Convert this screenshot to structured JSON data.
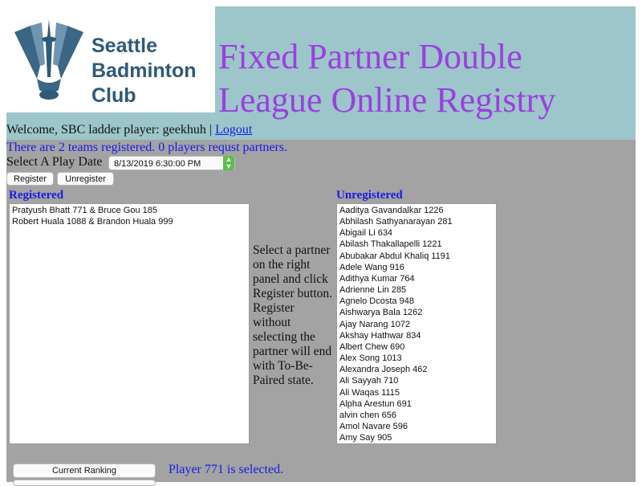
{
  "header": {
    "title": "Fixed Partner Double League Online Registry",
    "logo_line1": "Seattle",
    "logo_line2": "Badminton",
    "logo_line3": "Club"
  },
  "welcome": {
    "text": "Welcome, SBC ladder player: geekhuh |",
    "logout_label": "Logout"
  },
  "status_text": "There are 2 teams registered. 0 players requst partners.",
  "play_date": {
    "label": "Select A Play Date",
    "selected": "8/13/2019 6:30:00 PM"
  },
  "buttons": {
    "register": "Register",
    "unregister": "Unregister",
    "current_ranking": "Current Ranking"
  },
  "registered": {
    "heading": "Registered",
    "items": [
      "Pratyush Bhatt 771 & Bruce Gou 185",
      "Robert Huala 1088 & Brandon Huala 999"
    ]
  },
  "instructions": "Select a partner on the right panel and click Register button. Register without selecting the partner will end with To-Be-Paired state.",
  "unregistered": {
    "heading": "Unregistered",
    "items": [
      "Aaditya Gavandalkar 1226",
      "Abhilash Sathyanarayan 281",
      "Abigail Li 634",
      "Abilash Thakallapelli 1221",
      "Abubakar Abdul Khaliq 1191",
      "Adele Wang 916",
      "Adithya Kumar 764",
      "Adrienne Lin 285",
      "Agnelo Dcosta 948",
      "Aishwarya Bala 1262",
      "Ajay Narang 1072",
      "Akshay Hathwar 834",
      "Albert Chew 690",
      "Alex Song 1013",
      "Alexandra Joseph 462",
      "Ali Sayyah 710",
      "Ali Waqas 1115",
      "Alpha Arestun 691",
      "alvin chen 656",
      "Amol Navare 596",
      "Amy Say 905"
    ]
  },
  "selection_message": "Player 771 is selected.",
  "colors": {
    "header_bg": "#9cc6c9",
    "page_bg": "#a3a3a3",
    "title": "#9b3fe0",
    "link_blue": "#1a1ae8",
    "logo_blue": "#3b6785"
  }
}
